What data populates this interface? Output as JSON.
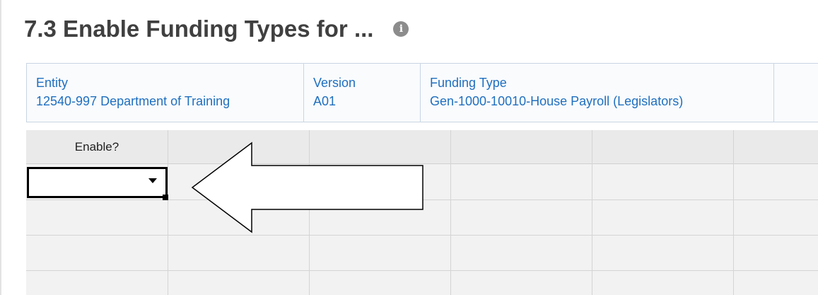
{
  "page": {
    "title": "7.3 Enable Funding Types for ...",
    "info_icon": "info-icon"
  },
  "pov": [
    {
      "label": "Entity",
      "value": "12540-997 Department of Training"
    },
    {
      "label": "Version",
      "value": "A01"
    },
    {
      "label": "Funding Type",
      "value": "Gen-1000-10010-House Payroll (Legislators)"
    }
  ],
  "grid": {
    "columns": [
      "Enable?",
      "",
      "",
      "",
      "",
      ""
    ],
    "selected_cell_value": "",
    "rows": 4
  },
  "annotation": {
    "shape": "left-arrow"
  },
  "colors": {
    "title": "#404040",
    "pov_text": "#1f6fbf",
    "grid_background": "#f2f2f2",
    "icon": "#8c8c8c"
  }
}
